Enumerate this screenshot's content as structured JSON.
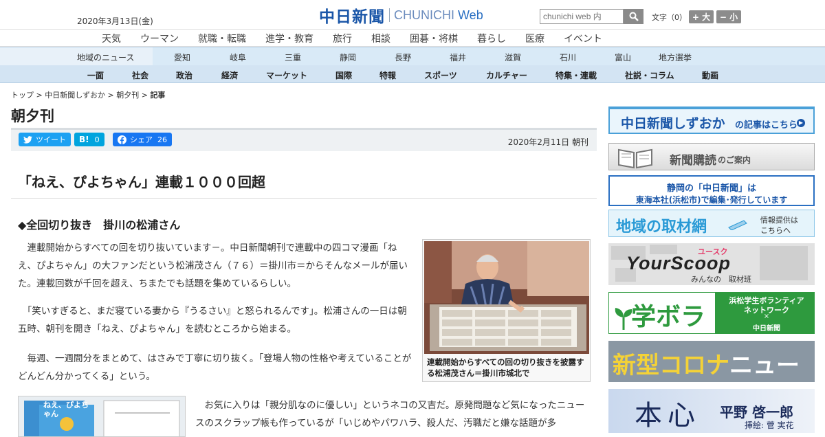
{
  "header": {
    "date": "2020年3月13日(金)",
    "logo_jp": "中日新聞",
    "logo_en_a": "CHUNICHI",
    "logo_en_b": "Web",
    "search_placeholder": "chunichi web 内",
    "text_size_label": "文字（0）",
    "bigger_label": "+ 大",
    "smaller_label": "− 小"
  },
  "global_nav": [
    "天気",
    "ウーマン",
    "就職・転職",
    "進学・教育",
    "旅行",
    "相談",
    "囲碁・将棋",
    "暮らし",
    "医療",
    "イベント"
  ],
  "region_nav": {
    "label": "地域のニュース",
    "items": [
      "愛知",
      "岐阜",
      "三重",
      "静岡",
      "長野",
      "福井",
      "滋賀",
      "石川",
      "富山",
      "地方選挙"
    ]
  },
  "category_nav": [
    "一面",
    "社会",
    "政治",
    "経済",
    "マーケット",
    "国際",
    "特報",
    "スポーツ",
    "カルチャー",
    "特集・連載",
    "社説・コラム",
    "動画"
  ],
  "breadcrumb": {
    "items": [
      "トップ",
      "中日新聞しずおか",
      "朝夕刊"
    ],
    "current": "記事"
  },
  "page_title": "朝夕刊",
  "share": {
    "tweet_label": "ツイート",
    "hatena_label": "B!",
    "hatena_count": "0",
    "facebook_label": "シェア",
    "facebook_count": "26"
  },
  "pub_date": "2020年2月11日 朝刊",
  "article": {
    "headline": "「ねえ、ぴよちゃん」連載１０００回超",
    "subhead": "◆全回切り抜き　掛川の松浦さん",
    "paragraphs": [
      "　連載開始からすべての回を切り抜いています－。中日新聞朝刊で連載中の四コマ漫画「ねえ、ぴよちゃん」の大ファンだという松浦茂さん（７６）＝掛川市＝からそんなメールが届いた。連載回数が千回を超え、ちまたでも話題を集めているらしい。",
      "　「笑いすぎると、まだ寝ている妻から『うるさい』と怒られるんです」。松浦さんの一日は朝五時、朝刊を開き「ねえ、ぴよちゃん」を読むところから始まる。",
      "　毎週、一週間分をまとめて、はさみで丁寧に切り抜く。「登場人物の性格や考えていることがどんどん分かってくる」という。",
      "　お気に入りは「親分肌なのに優しい」というネコの又吉だ。原発問題など気になったニュースのスクラップ帳も作っているが「いじめやパワハラ、殺人だ、汚職だと嫌な話題が多"
    ],
    "photo_caption": "連載開始からすべての回の切り抜きを披露する松浦茂さん＝掛川市城北で",
    "book_title": "ねえ、ぴよちゃん"
  },
  "sidebar": {
    "shizuoka": {
      "main": "中日新聞しずおか",
      "sub": "の記事はこちら"
    },
    "subscribe": {
      "main": "新聞購読",
      "sub": "のご案内"
    },
    "hq": {
      "line1": "静岡の「中日新聞」は",
      "line2": "東海本社(浜松市)で編集･発行しています"
    },
    "network": {
      "main": "地域の取材網",
      "sub1": "情報提供は",
      "sub2": "こちらへ"
    },
    "yourscoop": {
      "ruby": "ユースク",
      "logo": "YourScoop",
      "sub": "みんなの　取材班"
    },
    "gakubora": {
      "main": "学ボラ",
      "right1": "浜松学生ボランティア",
      "right2": "ネットワーク",
      "right3": "×",
      "right4": "中日新聞"
    },
    "corona": {
      "main": "新型コロナ",
      "sub": "ニュース"
    },
    "honshin": {
      "main": "本心",
      "author": "平野 啓一郎",
      "illus": "挿絵: 菅 実花"
    }
  },
  "colors": {
    "brand_blue": "#1a56a8",
    "twitter": "#1da1f2",
    "hatena": "#00a4de",
    "facebook": "#1877f2",
    "gakubora_green": "#2e9a3e",
    "corona_gray": "#8a97a3"
  }
}
